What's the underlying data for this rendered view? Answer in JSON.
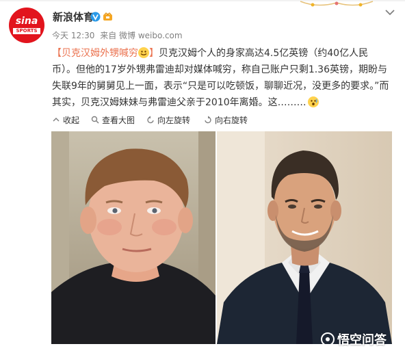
{
  "account": {
    "name": "新浪体育",
    "avatar_text": "sina",
    "avatar_sub": "SPORTS"
  },
  "meta": {
    "time": "今天 12:30",
    "source": "来自 微博 weibo.com"
  },
  "post": {
    "topic": "【贝克汉姆外甥喊穷",
    "topic_end": "】",
    "line1": "贝克汉姆个人的身家高达4.5亿英镑（约40亿人民",
    "line2": "币）。但他的17岁外甥弗雷迪却对媒体喊穷，称自己账户只剩1.36英镑，期盼与",
    "line3": "失联9年的舅舅见上一面，表示“只是可以吃顿饭，聊聊近况，没更多的要求。”而",
    "line4": "其实，贝克汉姆妹妹与弗雷迪父亲于2010年离婚。这………"
  },
  "actions": {
    "collapse": "收起",
    "view_large": "查看大图",
    "rotate_left": "向左旋转",
    "rotate_right": "向右旋转"
  },
  "watermark": {
    "text": "悟空问答"
  },
  "colors": {
    "accent_orange": "#eb7350",
    "brand_red": "#e2141d",
    "verified_blue": "#2a9ae8",
    "meta_gray": "#808080"
  },
  "icons": {
    "verified": "verified-v-icon",
    "collapse": "collapse-up-icon",
    "view_large": "magnify-icon",
    "rotate_left": "rotate-left-icon",
    "rotate_right": "rotate-right-icon",
    "more": "chevron-down-icon"
  }
}
